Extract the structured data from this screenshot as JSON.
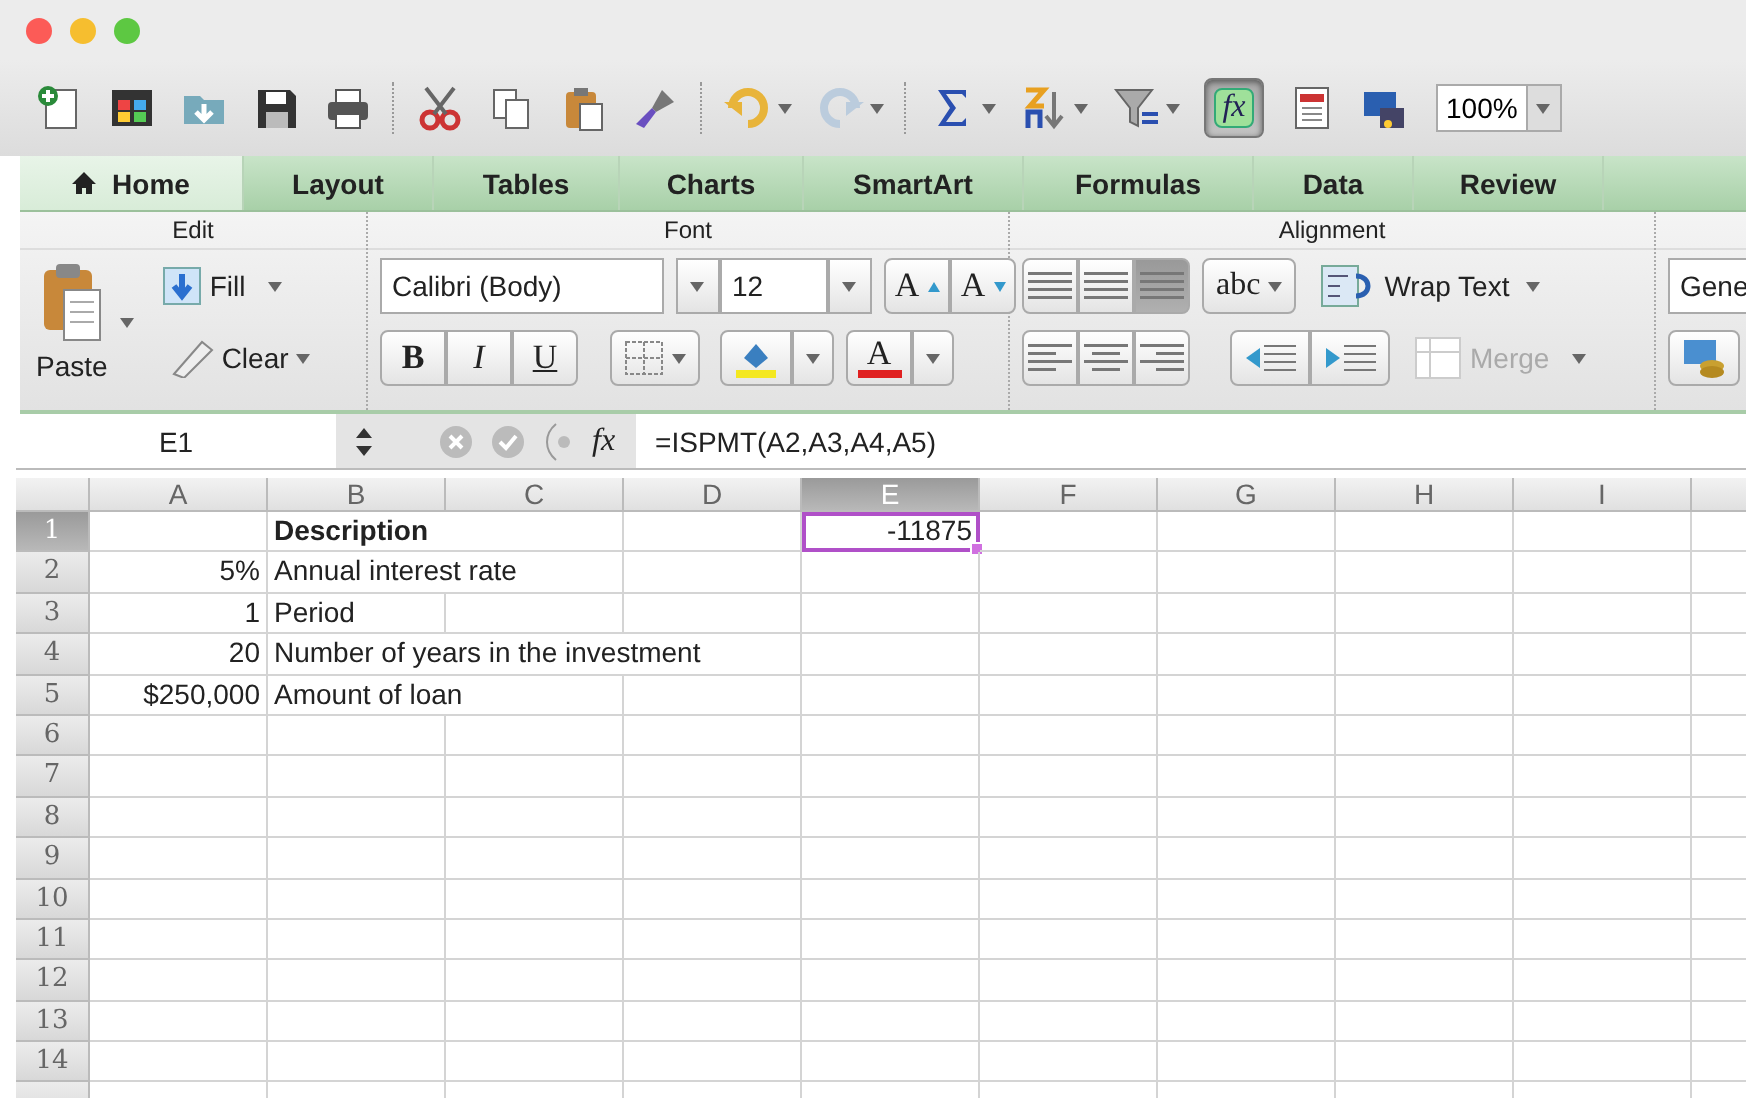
{
  "toolbar": {
    "formula_button": {
      "label": "fx",
      "on": true
    },
    "zoom": "100%"
  },
  "tabs": [
    {
      "label": "Home",
      "selected": true
    },
    {
      "label": "Layout",
      "selected": false
    },
    {
      "label": "Tables",
      "selected": false
    },
    {
      "label": "Charts",
      "selected": false
    },
    {
      "label": "SmartArt",
      "selected": false
    },
    {
      "label": "Formulas",
      "selected": false
    },
    {
      "label": "Data",
      "selected": false
    },
    {
      "label": "Review",
      "selected": false
    }
  ],
  "ribbon": {
    "edit": {
      "title": "Edit",
      "paste": "Paste",
      "fill": "Fill",
      "clear": "Clear"
    },
    "font": {
      "title": "Font",
      "font_name": "Calibri (Body)",
      "font_size": "12",
      "size_buttons": [
        "A",
        "A"
      ],
      "style_buttons": [
        "B",
        "I",
        "U"
      ],
      "font_color_label": "A"
    },
    "alignment": {
      "title": "Alignment",
      "vertical_align": [
        {
          "selected": false
        },
        {
          "selected": false
        },
        {
          "selected": true
        }
      ],
      "orientation": "abc",
      "wrap_text": "Wrap Text",
      "merge": {
        "label": "Merge",
        "disabled": true
      }
    },
    "number": {
      "format": "Gene"
    }
  },
  "formula_bar": {
    "name_box": "E1",
    "function_symbol": "fx",
    "formula": "=ISPMT(A2,A3,A4,A5)"
  },
  "sheet": {
    "columns": [
      {
        "label": "A",
        "selected": false
      },
      {
        "label": "B",
        "selected": false
      },
      {
        "label": "C",
        "selected": false
      },
      {
        "label": "D",
        "selected": false
      },
      {
        "label": "E",
        "selected": true
      },
      {
        "label": "F",
        "selected": false
      },
      {
        "label": "G",
        "selected": false
      },
      {
        "label": "H",
        "selected": false
      },
      {
        "label": "I",
        "selected": false
      }
    ],
    "rows": [
      {
        "header": "1",
        "selected": true,
        "b": {
          "text": "Description",
          "kind": "text",
          "bold": true
        },
        "e": {
          "text": "-11875",
          "kind": "number",
          "selected": true
        }
      },
      {
        "header": "2",
        "selected": false,
        "a": {
          "text": "5%",
          "kind": "number"
        },
        "b": {
          "text": "Annual interest rate",
          "kind": "text"
        }
      },
      {
        "header": "3",
        "selected": false,
        "a": {
          "text": "1",
          "kind": "number"
        },
        "b": {
          "text": "Period",
          "kind": "text"
        }
      },
      {
        "header": "4",
        "selected": false,
        "a": {
          "text": "20",
          "kind": "number"
        },
        "b": {
          "text": "Number of years in the investment",
          "kind": "text"
        }
      },
      {
        "header": "5",
        "selected": false,
        "a": {
          "text": "$250,000",
          "kind": "number"
        },
        "b": {
          "text": "Amount of loan",
          "kind": "text"
        }
      },
      {
        "header": "6",
        "selected": false
      },
      {
        "header": "7",
        "selected": false
      },
      {
        "header": "8",
        "selected": false
      },
      {
        "header": "9",
        "selected": false
      },
      {
        "header": "10",
        "selected": false
      },
      {
        "header": "11",
        "selected": false
      },
      {
        "header": "12",
        "selected": false
      },
      {
        "header": "13",
        "selected": false
      },
      {
        "header": "14",
        "selected": false
      }
    ]
  }
}
